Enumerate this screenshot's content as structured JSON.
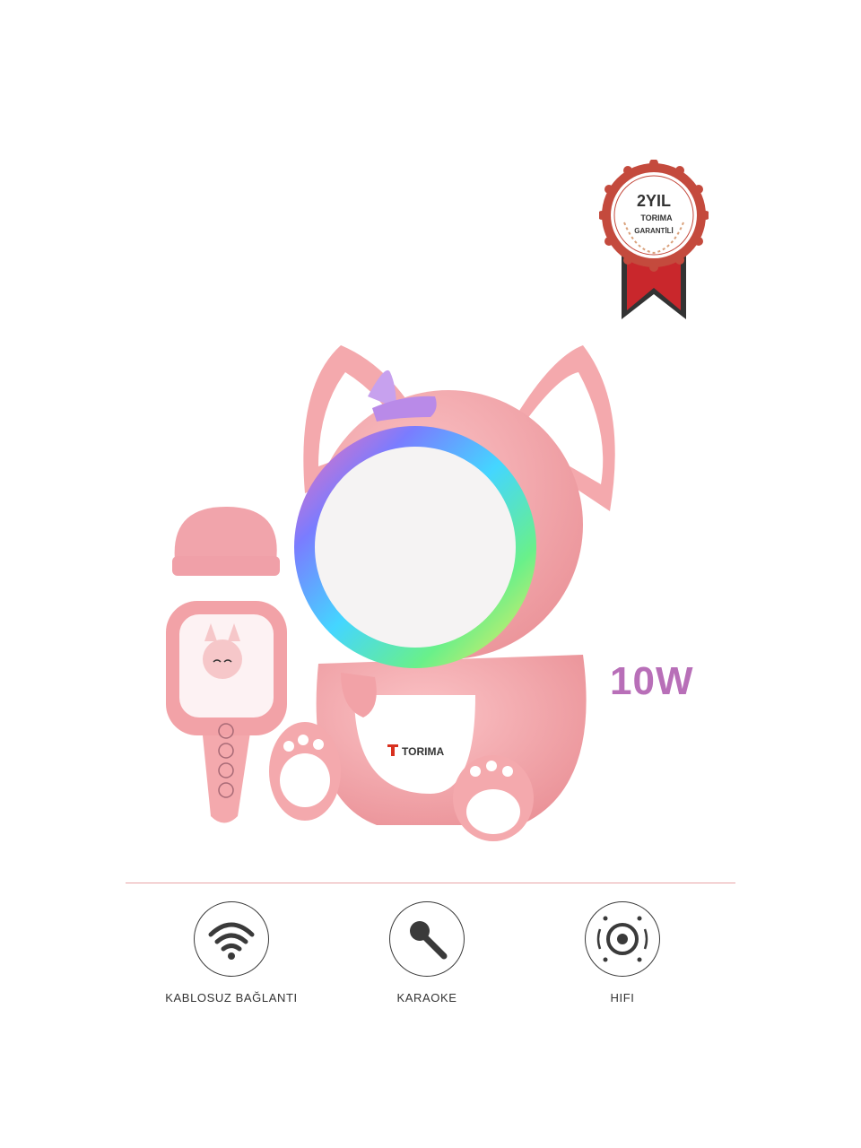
{
  "badge": {
    "years": "2YIL",
    "brand": "TORIMA",
    "caption": "GARANTİLİ",
    "colors": {
      "ring": "#c44a3d",
      "ribbon_light": "#c9272c",
      "ribbon_dark": "#333333"
    }
  },
  "product": {
    "speaker_brand": "TORIMA",
    "power": "10W",
    "colors": {
      "body": "#f4a9ad",
      "body_shade": "#e98e94",
      "grill": "#f5f3f3",
      "accent": "#d8301f"
    }
  },
  "features": [
    {
      "label": "KABLOSUZ BAĞLANTI",
      "icon": "wifi-icon"
    },
    {
      "label": "KARAOKE",
      "icon": "microphone-icon"
    },
    {
      "label": "HIFI",
      "icon": "speaker-icon"
    }
  ],
  "colors": {
    "divider": "#e8a3a6",
    "power_text": "#b86fb8"
  }
}
